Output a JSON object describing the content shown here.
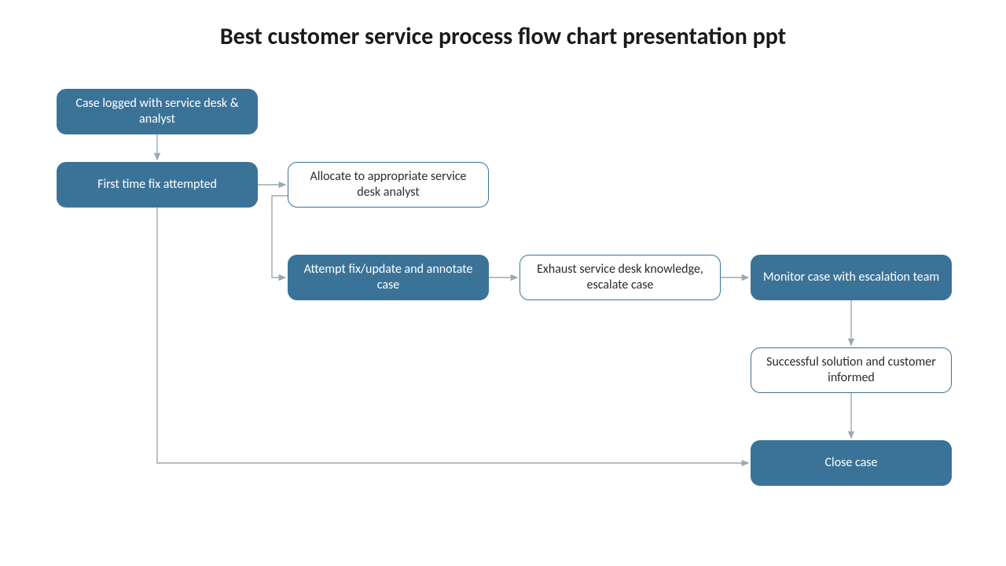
{
  "title": "Best customer service process flow chart presentation ppt",
  "nodes": {
    "n1": "Case logged with service desk & analyst",
    "n2": "First time fix attempted",
    "n3": "Allocate to appropriate service desk analyst",
    "n4": "Attempt fix/update and annotate case",
    "n5": "Exhaust service desk knowledge, escalate case",
    "n6": "Monitor case with escalation team",
    "n7": "Successful solution and customer informed",
    "n8": "Close case"
  },
  "chart_data": {
    "type": "flowchart",
    "title": "Best customer service process flow chart presentation ppt",
    "nodes": [
      {
        "id": "n1",
        "label": "Case logged with service desk & analyst",
        "style": "filled"
      },
      {
        "id": "n2",
        "label": "First time fix attempted",
        "style": "filled"
      },
      {
        "id": "n3",
        "label": "Allocate to appropriate service desk analyst",
        "style": "outlined"
      },
      {
        "id": "n4",
        "label": "Attempt fix/update and annotate case",
        "style": "filled"
      },
      {
        "id": "n5",
        "label": "Exhaust service desk knowledge, escalate case",
        "style": "outlined"
      },
      {
        "id": "n6",
        "label": "Monitor case with escalation team",
        "style": "filled"
      },
      {
        "id": "n7",
        "label": "Successful solution and customer informed",
        "style": "outlined"
      },
      {
        "id": "n8",
        "label": "Close case",
        "style": "filled"
      }
    ],
    "edges": [
      {
        "from": "n1",
        "to": "n2"
      },
      {
        "from": "n2",
        "to": "n3"
      },
      {
        "from": "n3",
        "to": "n4"
      },
      {
        "from": "n4",
        "to": "n5"
      },
      {
        "from": "n5",
        "to": "n6"
      },
      {
        "from": "n6",
        "to": "n7"
      },
      {
        "from": "n7",
        "to": "n8"
      },
      {
        "from": "n2",
        "to": "n8"
      }
    ]
  }
}
